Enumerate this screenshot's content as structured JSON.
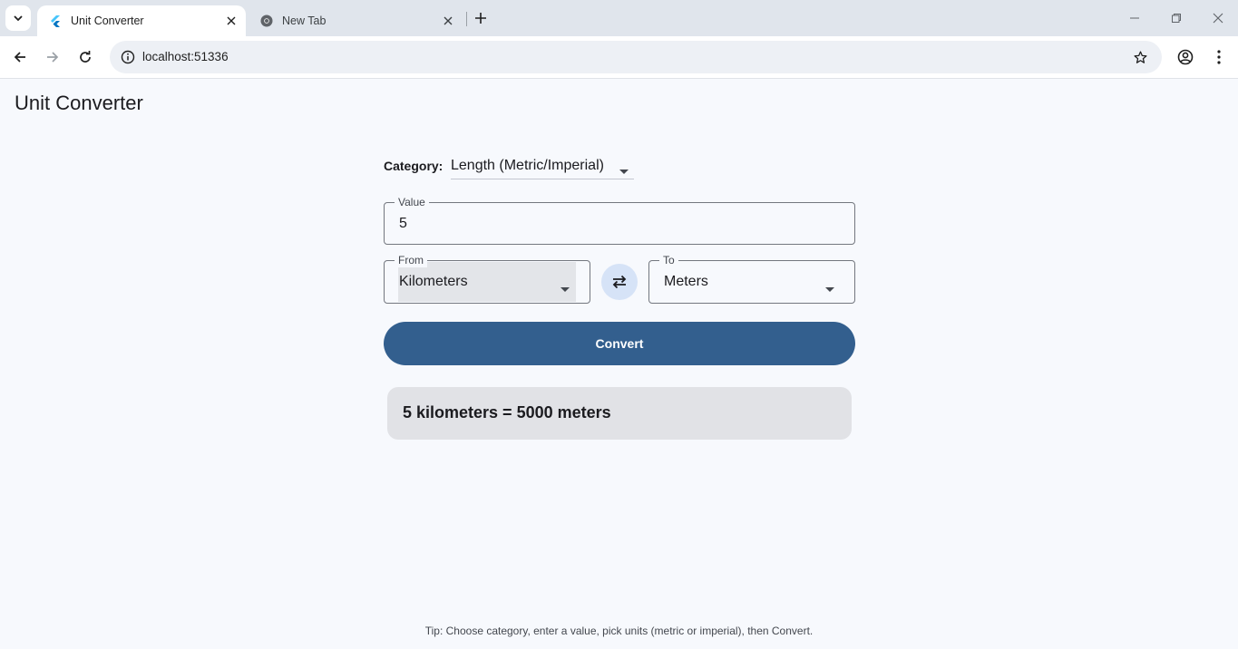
{
  "browser": {
    "tabs": [
      {
        "title": "Unit Converter",
        "active": true,
        "icon": "flutter-icon"
      },
      {
        "title": "New Tab",
        "active": false,
        "icon": "chrome-icon"
      }
    ],
    "url": "localhost:51336"
  },
  "app": {
    "title": "Unit Converter",
    "category_label": "Category:",
    "category_value": "Length (Metric/Imperial)",
    "value_label": "Value",
    "value": "5",
    "from_label": "From",
    "from_value": "Kilometers",
    "to_label": "To",
    "to_value": "Meters",
    "convert_label": "Convert",
    "result": "5 kilometers = 5000 meters",
    "tip": "Tip: Choose category, enter a value, pick units (metric or imperial), then Convert."
  },
  "colors": {
    "primary": "#335f8e",
    "swap_bg": "#d6e3f7",
    "result_bg": "#e1e2e6",
    "page_bg": "#f7f9fd"
  }
}
